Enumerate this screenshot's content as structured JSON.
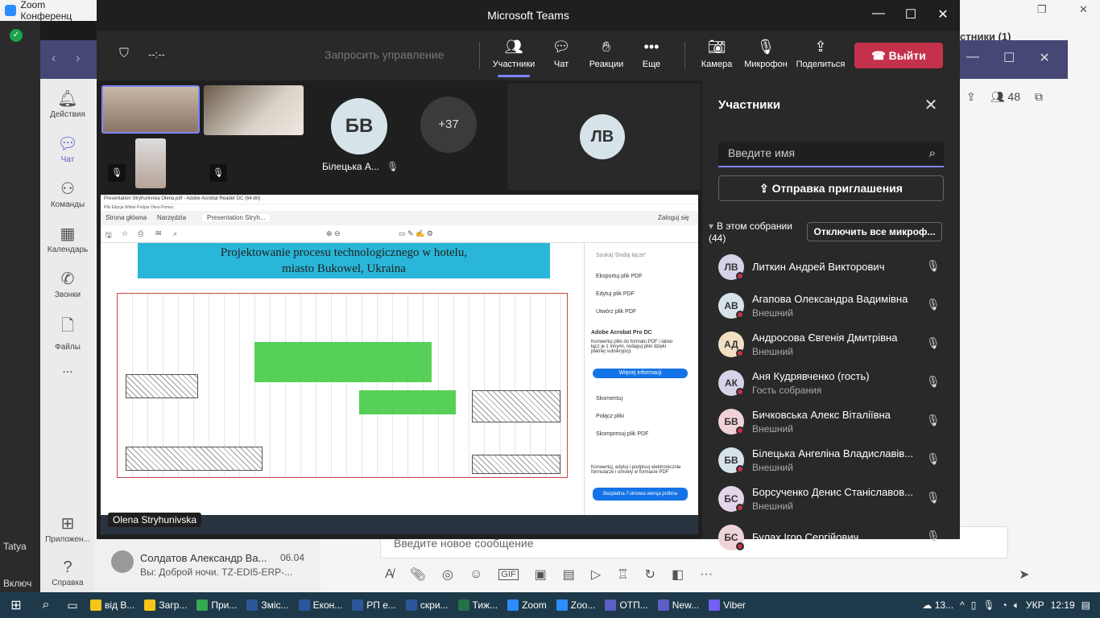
{
  "background": {
    "zoom_title": "Zoom Конференц",
    "participants_hint": "стники (1)",
    "tatya_label": "Tatya",
    "include_label": "Включ",
    "rail": [
      {
        "label": "Действия",
        "icon": "bell-icon"
      },
      {
        "label": "Чат",
        "icon": "chat-icon"
      },
      {
        "label": "Команды",
        "icon": "teams-icon"
      },
      {
        "label": "Календарь",
        "icon": "calendar-icon"
      },
      {
        "label": "Звонки",
        "icon": "phone-icon"
      },
      {
        "label": "Файлы",
        "icon": "file-icon"
      },
      {
        "label": "...",
        "icon": "more-icon"
      },
      {
        "label": "Приложен...",
        "icon": "apps-icon"
      },
      {
        "label": "Справка",
        "icon": "help-icon"
      }
    ],
    "chat_item": {
      "name": "Солдатов Александр Ва...",
      "date": "06.04",
      "preview": "Вы: Доброй ночи. TZ-EDI5-ERP-..."
    },
    "compose_placeholder": "Введите новое сообщение",
    "participant_count": "48"
  },
  "meeting": {
    "window_title": "Microsoft Teams",
    "timer": "--:--",
    "request_control": "Запросить управление",
    "toolbar": {
      "participants": "Участники",
      "chat": "Чат",
      "reactions": "Реакции",
      "more": "Еще",
      "camera": "Камера",
      "mic": "Микрофон",
      "share": "Поделиться",
      "leave": "Выйти"
    },
    "tiles": {
      "bv_initials": "БВ",
      "bv_name": "Білецька А...",
      "more_count": "+37",
      "lv_initials": "ЛВ"
    },
    "presenter": "Olena Stryhunivska",
    "screen": {
      "title": "Presentation Stryhunivska Olena.pdf - Adobe Acrobat Reader DC (64-bit)",
      "menu": "Plik   Edycja   Widok   Podpis   Okno   Pomoc",
      "tab_home": "Strona główna",
      "tab_tools": "Narzędzia",
      "tab_doc": "Presentation Stryh...",
      "login": "Zaloguj się",
      "slide_title_1": "Projektowanie procesu technologicznego w hotelu,",
      "slide_title_2": "miasto Bukowel, Ukraina",
      "side_search": "Szukaj 'Dodaj łącze'",
      "side_export": "Eksportuj plik PDF",
      "side_edit": "Edytuj plik PDF",
      "side_create": "Utwórz plik PDF",
      "side_pro": "Adobe Acrobat Pro DC",
      "side_pro_desc": "Konwertuj pliki do formatu PDF i łatwo łącz je z innymi, redaguj pliki dzięki płatnej subskrypcji.",
      "side_more": "Więcej informacji",
      "side_comment": "Skomentuj",
      "side_combine": "Połącz pliki",
      "side_compress": "Skompresuj plik PDF",
      "side_footer": "Konwertuj, edytuj i podpisuj elektronicznie formularze i umowy w formacie PDF",
      "side_trial": "Bezpłatna 7-dniowa wersja próbna"
    }
  },
  "panel": {
    "title": "Участники",
    "search_placeholder": "Введите имя",
    "invite": "Отправка приглашения",
    "section": "В этом собрании (44)",
    "mute_all": "Отключить все микроф...",
    "participants": [
      {
        "initials": "ЛВ",
        "name": "Литкин Андрей Викторович",
        "sub": "",
        "color": "#d6d3e8"
      },
      {
        "initials": "АВ",
        "name": "Агапова Олександра Вадимівна",
        "sub": "Внешний",
        "color": "#d6e4ea"
      },
      {
        "initials": "АД",
        "name": "Андросова Євгенія Дмитрівна",
        "sub": "Внешний",
        "color": "#f3e0c4"
      },
      {
        "initials": "АК",
        "name": "Аня Кудрявченко (гость)",
        "sub": "Гость собрания",
        "color": "#d6d3e8"
      },
      {
        "initials": "БВ",
        "name": "Бичковська Алекс Віталіївна",
        "sub": "Внешний",
        "color": "#f0d3d8"
      },
      {
        "initials": "БВ",
        "name": "Білецька Ангеліна Владиславів...",
        "sub": "Внешний",
        "color": "#d6e4ea"
      },
      {
        "initials": "БС",
        "name": "Борсученко Денис Станіславов...",
        "sub": "Внешний",
        "color": "#e4d6ea"
      },
      {
        "initials": "БС",
        "name": "Булах Ігор Сергійович",
        "sub": "",
        "color": "#f0d3d8"
      }
    ]
  },
  "taskbar": {
    "items": [
      {
        "label": "від В...",
        "color": "#f5c518"
      },
      {
        "label": "Загр...",
        "color": "#f5c518"
      },
      {
        "label": "При...",
        "color": "#34a853"
      },
      {
        "label": "Змiс...",
        "color": "#2b579a"
      },
      {
        "label": "Екон...",
        "color": "#2b579a"
      },
      {
        "label": "РП е...",
        "color": "#2b579a"
      },
      {
        "label": "скри...",
        "color": "#2b579a"
      },
      {
        "label": "Тиж...",
        "color": "#217346"
      },
      {
        "label": "Zoom",
        "color": "#2d8cff"
      },
      {
        "label": "Zoo...",
        "color": "#2d8cff"
      },
      {
        "label": "ОТП...",
        "color": "#5b5fc7"
      },
      {
        "label": "New...",
        "color": "#5b5fc7"
      },
      {
        "label": "Viber",
        "color": "#7360f2"
      }
    ],
    "weather": "13...",
    "lang": "УКР",
    "time": "12:19"
  }
}
